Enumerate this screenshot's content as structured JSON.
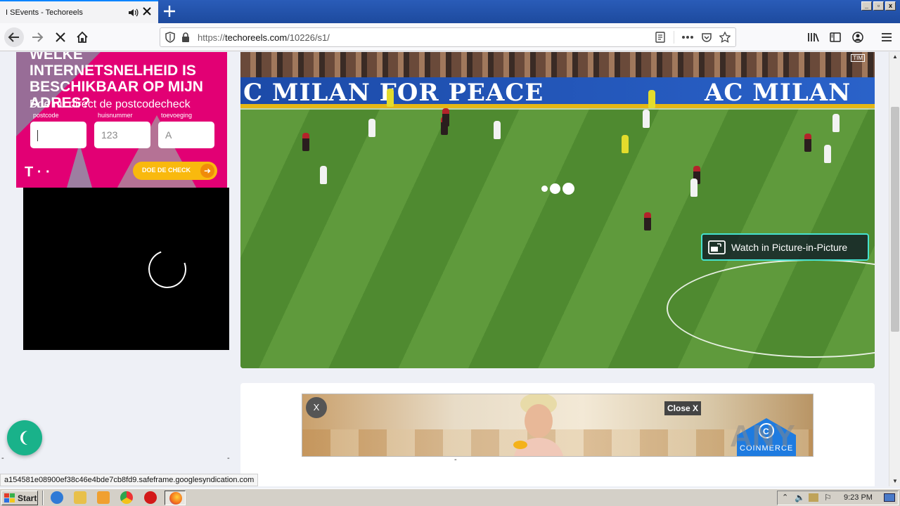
{
  "browser": {
    "tab_title": "I SEvents - Techoreels",
    "url_protocol": "https://",
    "url_host": "techoreels.com",
    "url_path": "/10226/s1/"
  },
  "pink_ad": {
    "headline": "WELKE INTERNETSNELHEID IS BESCHIKBAAR OP MIJN ADRES?",
    "subline": "Doe nu direct de postcodecheck",
    "fields": [
      {
        "label": "postcode",
        "value": ""
      },
      {
        "label": "huisnummer",
        "value": "123"
      },
      {
        "label": "toevoeging",
        "value": "A"
      }
    ],
    "logo": "T · ·",
    "cta": "DOE DE CHECK",
    "colors": {
      "bg": "#e20074",
      "cta": "#f9b90e"
    }
  },
  "video": {
    "banner_left": "C MILAN FOR PEACE",
    "banner_right": "AC MILAN",
    "corner_mark": "TIM",
    "pip_label": "Watch in Picture-in-Picture",
    "pip_border": "#45e1cf"
  },
  "banner_ad": {
    "close_circle": "X",
    "close_button": "Close X",
    "brand": "COINMERCE"
  },
  "page_marks": {
    "left_dash": "-",
    "right_dash": "-",
    "center_dash": "-"
  },
  "status_url": "a154581e08900ef38c46e4bde7cb8fd9.safeframe.googlesyndication.com",
  "taskbar": {
    "start_label": "Start",
    "clock": "9:23 PM"
  },
  "window_buttons": [
    "_",
    "▫",
    "x"
  ]
}
